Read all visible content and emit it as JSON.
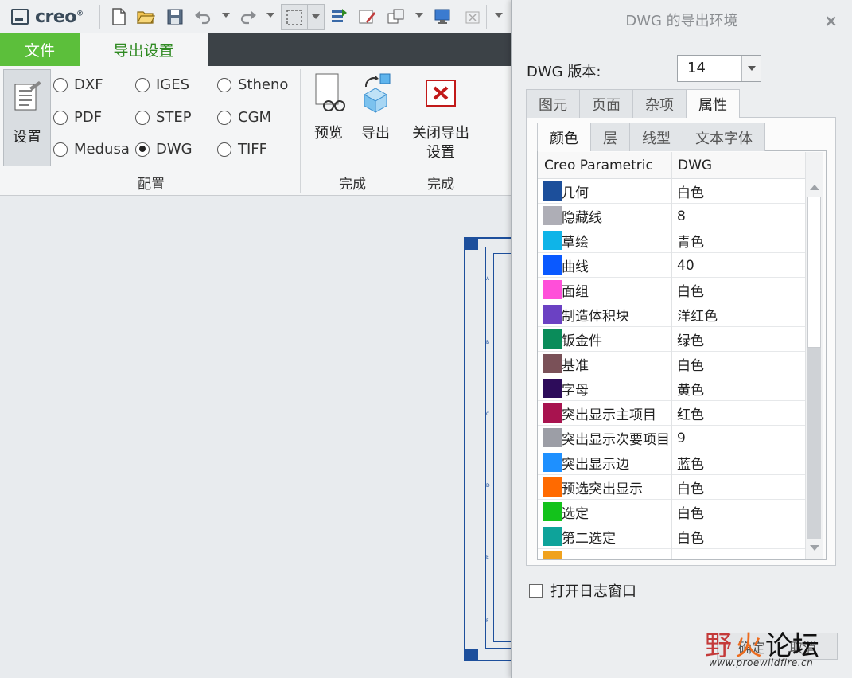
{
  "app": {
    "logo": "creo",
    "logo_mark": "®"
  },
  "ribbon": {
    "tabs": [
      {
        "label": "文件"
      },
      {
        "label": "导出设置"
      }
    ],
    "settings_label": "设置",
    "formats": [
      {
        "label": "DXF",
        "selected": false
      },
      {
        "label": "IGES",
        "selected": false
      },
      {
        "label": "Stheno",
        "selected": false
      },
      {
        "label": "PDF",
        "selected": false
      },
      {
        "label": "STEP",
        "selected": false
      },
      {
        "label": "CGM",
        "selected": false
      },
      {
        "label": "Medusa",
        "selected": false
      },
      {
        "label": "DWG",
        "selected": true
      },
      {
        "label": "TIFF",
        "selected": false
      }
    ],
    "group_config": "配置",
    "preview_label": "预览",
    "export_label": "导出",
    "group_finish_1": "完成",
    "close_label_1": "关闭导出",
    "close_label_2": "设置",
    "group_finish_2": "完成"
  },
  "drawing": {
    "ticks": [
      "A",
      "B",
      "C",
      "D",
      "E",
      "F"
    ]
  },
  "dialog": {
    "title": "DWG 的导出环境",
    "close": "×",
    "version_label": "DWG 版本:",
    "version_value": "14",
    "tabs": [
      {
        "label": "图元"
      },
      {
        "label": "页面"
      },
      {
        "label": "杂项"
      },
      {
        "label": "属性"
      }
    ],
    "active_tab": 3,
    "subtabs": [
      {
        "label": "颜色"
      },
      {
        "label": "层"
      },
      {
        "label": "线型"
      },
      {
        "label": "文本字体"
      }
    ],
    "active_subtab": 0,
    "table": {
      "headers": [
        "Creo Parametric",
        "DWG"
      ],
      "rows": [
        {
          "name": "几何",
          "value": "白色",
          "color": "#1c4f9b"
        },
        {
          "name": "隐藏线",
          "value": " 8",
          "color": "#aeaeb6"
        },
        {
          "name": "草绘",
          "value": "青色",
          "color": "#0fb4e8"
        },
        {
          "name": "曲线",
          "value": " 40",
          "color": "#0a59ff"
        },
        {
          "name": "面组",
          "value": "白色",
          "color": "#ff4fd9"
        },
        {
          "name": "制造体积块",
          "value": "洋红色",
          "color": "#6b41c3"
        },
        {
          "name": "钣金件",
          "value": "绿色",
          "color": "#0a8c5a"
        },
        {
          "name": "基准",
          "value": "白色",
          "color": "#7a5158"
        },
        {
          "name": "字母",
          "value": "黄色",
          "color": "#2d0c5a"
        },
        {
          "name": "突出显示主项目",
          "value": "红色",
          "color": "#a8134f"
        },
        {
          "name": "突出显示次要项目",
          "value": " 9",
          "color": "#9c9ea6"
        },
        {
          "name": "突出显示边",
          "value": "蓝色",
          "color": "#1e90ff"
        },
        {
          "name": "预选突出显示",
          "value": "白色",
          "color": "#ff6a00"
        },
        {
          "name": "选定",
          "value": "白色",
          "color": "#13c21b"
        },
        {
          "name": "第二选定",
          "value": "白色",
          "color": "#0ea39a"
        },
        {
          "name": "",
          "value": "",
          "color": "#f0a21e"
        }
      ]
    },
    "log_label": "打开日志窗口",
    "ok_label": "确定",
    "cancel_label": "取消"
  },
  "watermark": {
    "text1": "野",
    "text2": "火",
    "text3": "论坛",
    "url": "www.proewildfire.cn"
  }
}
